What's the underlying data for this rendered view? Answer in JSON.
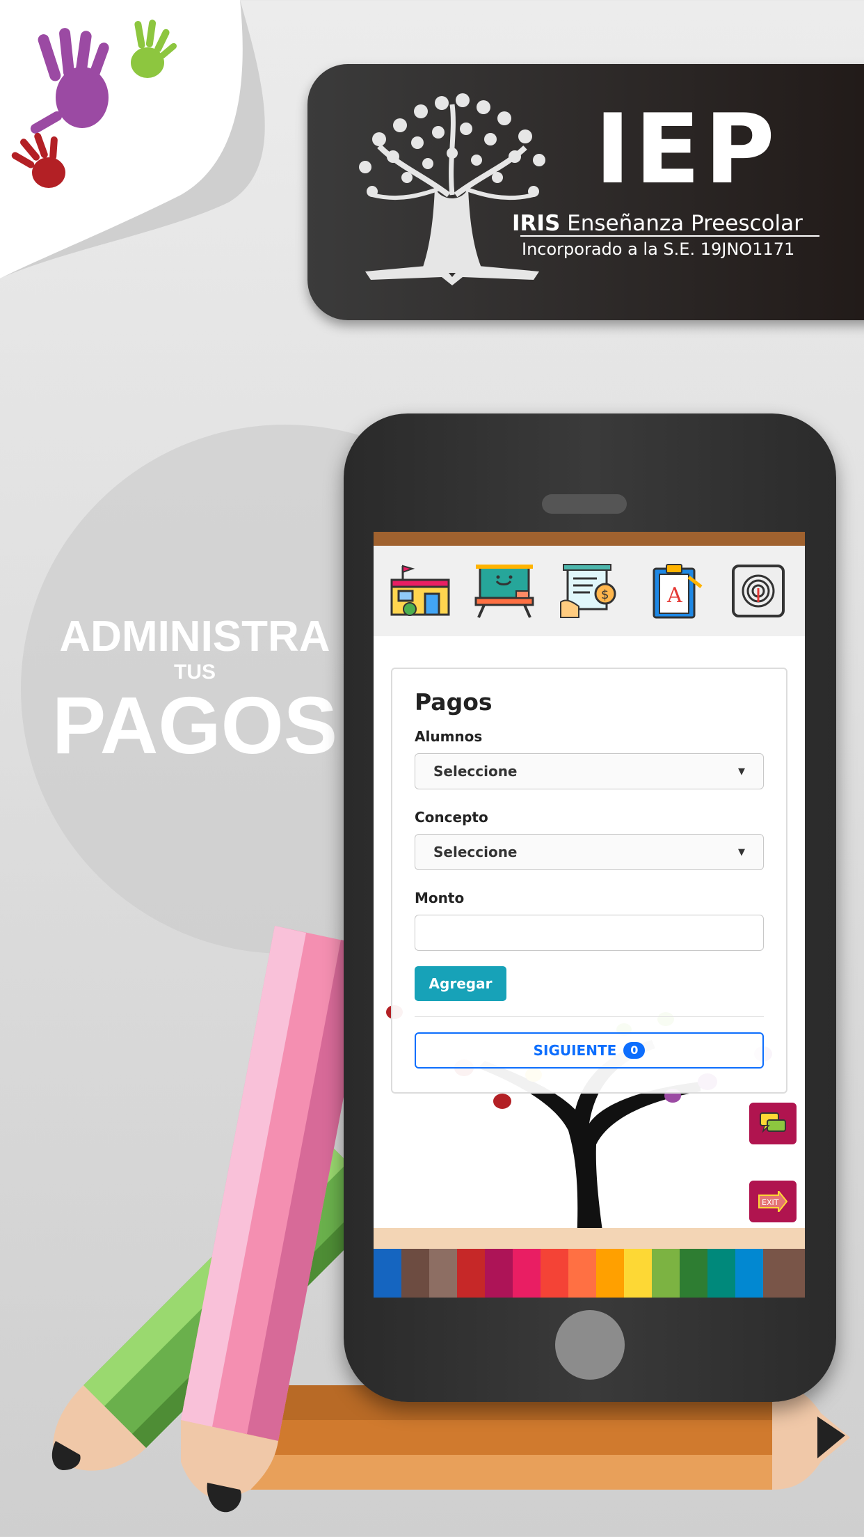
{
  "colors": {
    "brand_dark": "#2a2220",
    "accent_brown": "#a0622f",
    "primary": "#0d6efd",
    "info": "#17a2b8",
    "side_button": "#b0144f"
  },
  "header": {
    "acronym": "IEP",
    "name_bold": "IRIS",
    "name_rest": "Enseñanza Preescolar",
    "incorporation": "Incorporado a la S.E. 19JNO1171"
  },
  "slogan": {
    "line1": "ADMINISTRA",
    "line2": "TUS",
    "line3": "PAGOS"
  },
  "app": {
    "toolbar_icons": [
      "school-icon",
      "classroom-desk-icon",
      "payment-receipt-icon",
      "grades-clipboard-icon",
      "fingerprint-icon"
    ],
    "form": {
      "title": "Pagos",
      "alumnos_label": "Alumnos",
      "alumnos_value": "Seleccione",
      "concepto_label": "Concepto",
      "concepto_value": "Seleccione",
      "monto_label": "Monto",
      "monto_value": "",
      "add_label": "Agregar",
      "next_label": "SIGUIENTE",
      "next_count": "0"
    },
    "side_buttons": [
      "chat-icon",
      "exit-icon"
    ]
  }
}
